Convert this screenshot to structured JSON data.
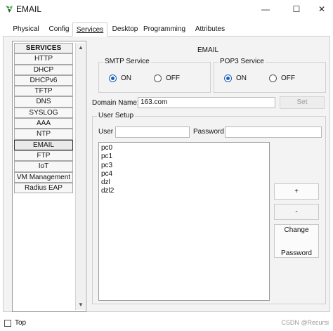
{
  "window": {
    "title": "EMAIL",
    "minimize_glyph": "—",
    "maximize_glyph": "☐",
    "close_glyph": "✕"
  },
  "tabs": [
    {
      "label": "Physical"
    },
    {
      "label": "Config"
    },
    {
      "label": "Services",
      "active": true
    },
    {
      "label": "Desktop"
    },
    {
      "label": "Programming"
    },
    {
      "label": "Attributes"
    }
  ],
  "services": {
    "header": "SERVICES",
    "items": [
      "HTTP",
      "DHCP",
      "DHCPv6",
      "TFTP",
      "DNS",
      "SYSLOG",
      "AAA",
      "NTP",
      "EMAIL",
      "FTP",
      "IoT",
      "VM Management",
      "Radius EAP"
    ],
    "selected": "EMAIL"
  },
  "email": {
    "heading": "EMAIL",
    "smtp": {
      "title": "SMTP Service",
      "on_label": "ON",
      "off_label": "OFF",
      "value": "ON"
    },
    "pop3": {
      "title": "POP3 Service",
      "on_label": "ON",
      "off_label": "OFF",
      "value": "ON"
    },
    "domain_label": "Domain Name:",
    "domain_value": "163.com",
    "set_button": "Set",
    "user_setup": {
      "title": "User Setup",
      "user_label": "User",
      "user_value": "",
      "password_label": "Password",
      "password_value": "",
      "users": [
        "pc0",
        "pc1",
        "pc3",
        "pc4",
        "dzl",
        "dzl2"
      ],
      "add_button": "+",
      "remove_button": "-",
      "change_password_button_line1": "Change",
      "change_password_button_line2": "Password"
    }
  },
  "footer": {
    "top_label": "Top",
    "top_checked": false,
    "watermark": "CSDN @Recursi"
  },
  "colors": {
    "accent": "#1a5fb4",
    "panel_bg": "#f3f3f3",
    "border": "#cfcfcf"
  }
}
